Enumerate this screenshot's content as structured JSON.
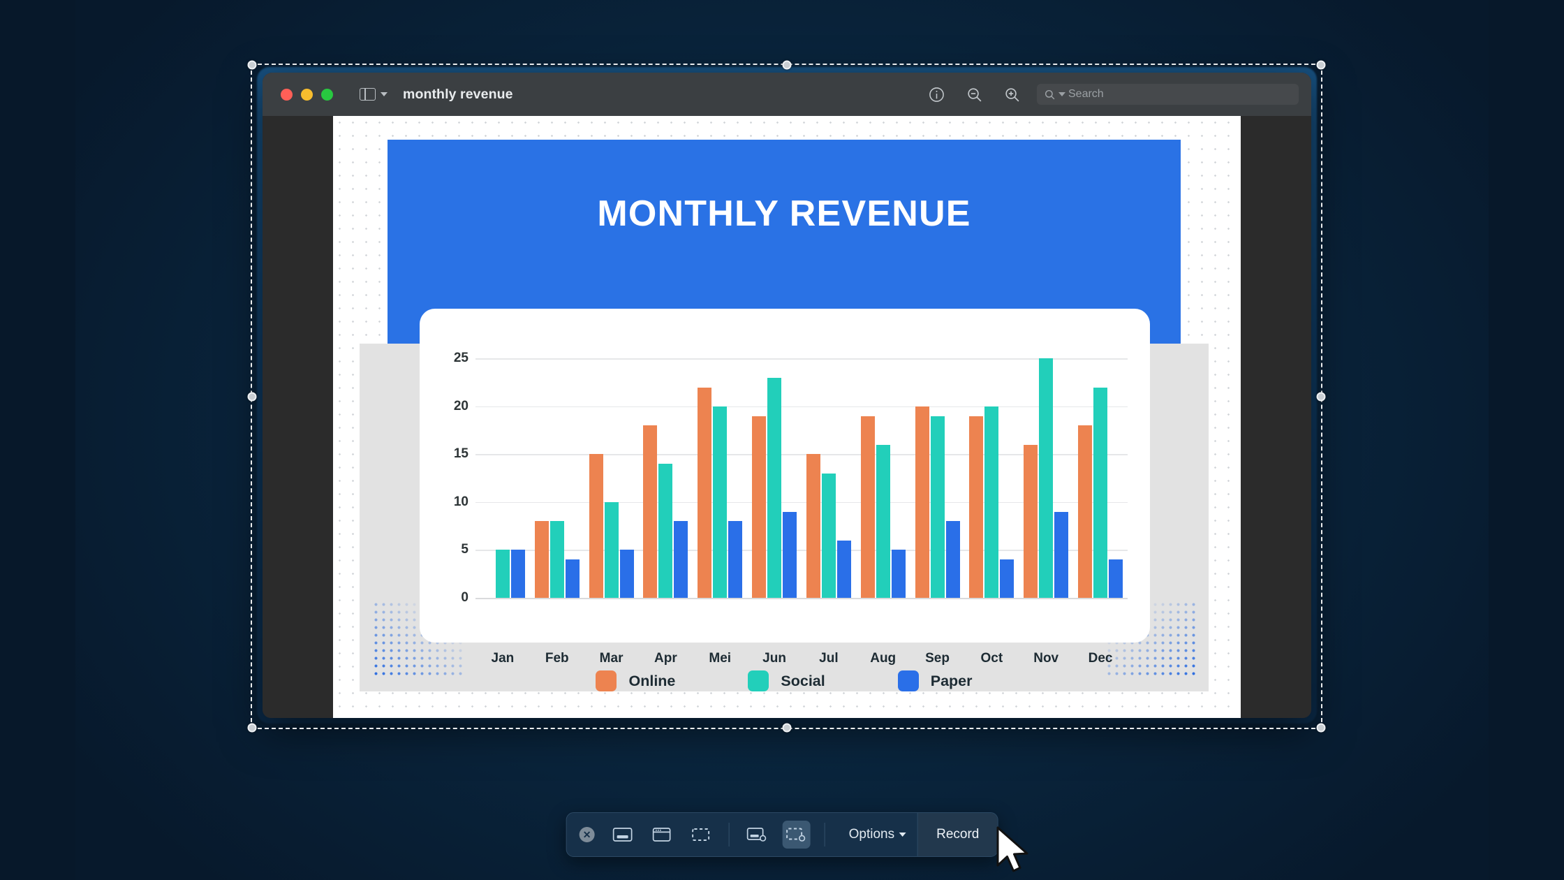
{
  "window": {
    "title": "monthly revenue",
    "traffic_lights": [
      "close",
      "minimize",
      "zoom"
    ],
    "sidebar_toggle": "sidebar-toggle",
    "toolbar_icons": [
      "info-icon",
      "zoom-out-icon",
      "zoom-in-icon",
      "share-icon",
      "markup-pen-icon",
      "chevron-down-icon",
      "rotate-icon",
      "annotate-icon",
      "signature-icon"
    ],
    "search": {
      "placeholder": "Search",
      "value": ""
    }
  },
  "slide": {
    "title": "MONTHLY REVENUE",
    "brand_color": "#2a72e5",
    "body_bg": "#e2e2e2",
    "decor": {
      "left": "halftone-dots",
      "right": "halftone-dots"
    }
  },
  "chart_data": {
    "type": "bar",
    "title": "MONTHLY REVENUE",
    "xlabel": "",
    "ylabel": "",
    "ylim": [
      0,
      27
    ],
    "yticks": [
      0,
      5,
      10,
      15,
      20,
      25
    ],
    "grid": true,
    "legend_position": "bottom",
    "categories": [
      "Jan",
      "Feb",
      "Mar",
      "Apr",
      "Mei",
      "Jun",
      "Jul",
      "Aug",
      "Sep",
      "Oct",
      "Nov",
      "Dec"
    ],
    "series": [
      {
        "name": "Online",
        "color": "#ed8350",
        "values": [
          0,
          8,
          15,
          18,
          22,
          19,
          15,
          19,
          20,
          19,
          16,
          18
        ]
      },
      {
        "name": "Social",
        "color": "#22cfba",
        "values": [
          5,
          8,
          10,
          14,
          20,
          23,
          13,
          16,
          19,
          20,
          25,
          22
        ]
      },
      {
        "name": "Paper",
        "color": "#2a6fe8",
        "values": [
          5,
          4,
          5,
          8,
          8,
          9,
          6,
          5,
          8,
          4,
          9,
          4
        ]
      }
    ]
  },
  "legend": [
    {
      "label": "Online",
      "color": "#ed8350"
    },
    {
      "label": "Social",
      "color": "#22cfba"
    },
    {
      "label": "Paper",
      "color": "#2a6fe8"
    }
  ],
  "capture_bar": {
    "close_label": "✕",
    "modes": [
      "capture-entire-screen-icon",
      "capture-window-icon",
      "capture-selected-portion-icon"
    ],
    "record_modes": [
      "record-entire-screen-icon",
      "record-selected-portion-icon"
    ],
    "active_mode": "record-selected-portion-icon",
    "options_label": "Options",
    "options_chevron": "chevron-down-icon",
    "record_label": "Record"
  }
}
